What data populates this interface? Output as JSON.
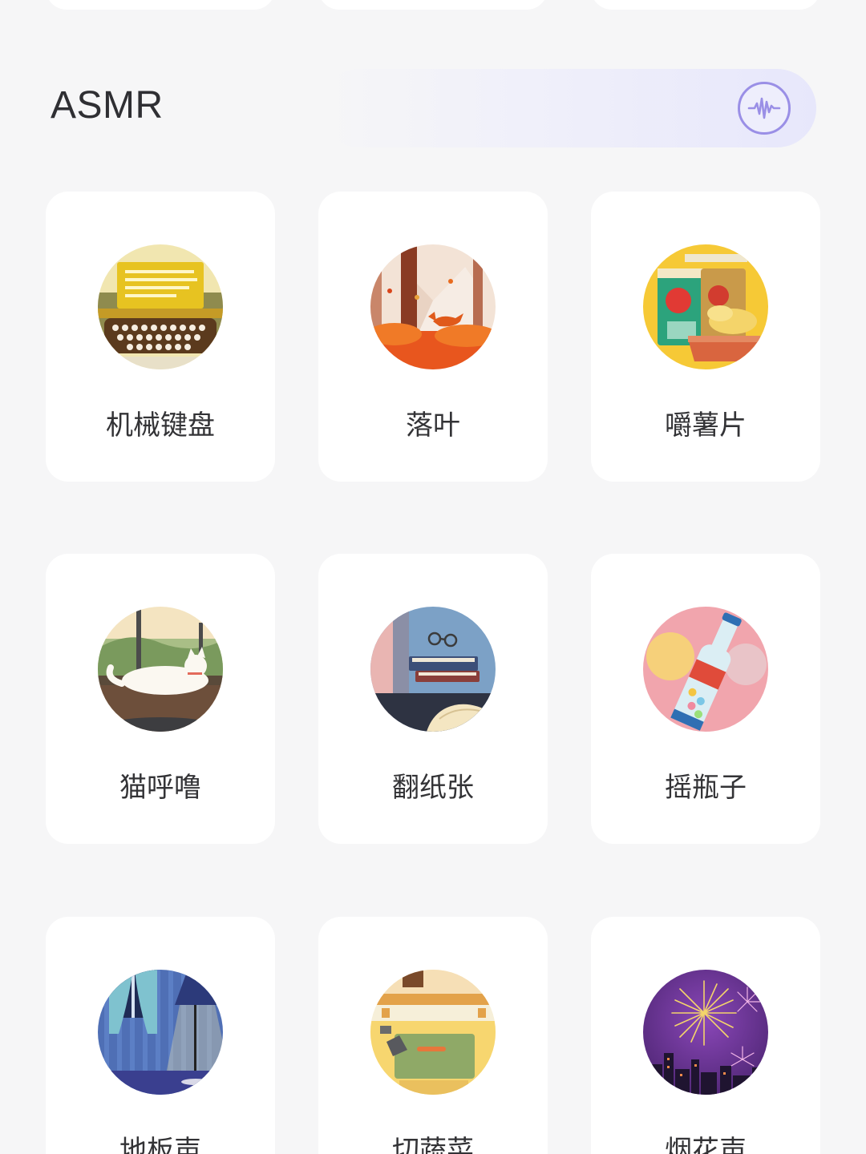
{
  "section": {
    "title": "ASMR",
    "action_icon": "sound-wave-icon",
    "accent_color": "#9a8fe6"
  },
  "sounds": [
    {
      "label": "机械键盘",
      "icon": "typewriter-keyboard"
    },
    {
      "label": "落叶",
      "icon": "autumn-fox-forest"
    },
    {
      "label": "嚼薯片",
      "icon": "potato-chips"
    },
    {
      "label": "猫呼噜",
      "icon": "sleeping-cat"
    },
    {
      "label": "翻纸张",
      "icon": "books-glasses"
    },
    {
      "label": "摇瓶子",
      "icon": "sugar-bottle"
    },
    {
      "label": "地板声",
      "icon": "room-floor-lamp"
    },
    {
      "label": "切蔬菜",
      "icon": "cutting-board"
    },
    {
      "label": "烟花声",
      "icon": "fireworks"
    }
  ]
}
